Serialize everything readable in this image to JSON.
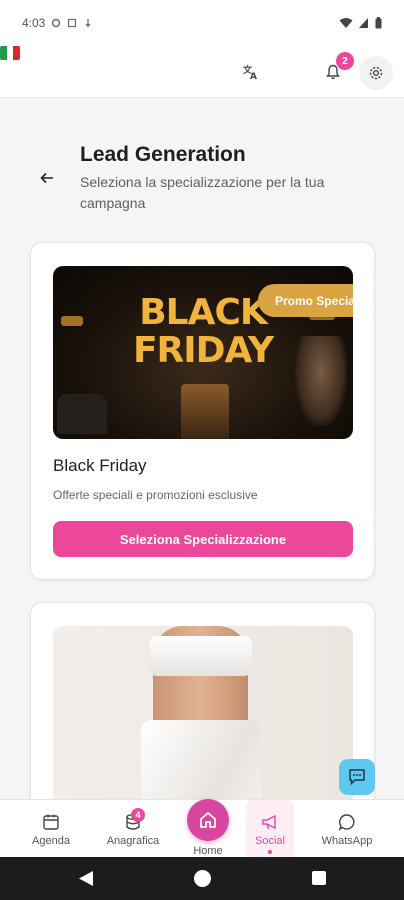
{
  "status_bar": {
    "time": "4:03"
  },
  "header": {
    "translate_icon": "translate-icon",
    "flag": "italy-flag",
    "notifications_count": "2",
    "settings_icon": "gear-icon"
  },
  "page": {
    "title": "Lead Generation",
    "subtitle": "Seleziona la specializzazione per la tua campagna"
  },
  "cards": [
    {
      "image_text_line1": "BLACK",
      "image_text_line2": "FRIDAY",
      "badge": "Promo Speciale",
      "title": "Black Friday",
      "description": "Offerte speciali e promozioni esclusive",
      "button": "Seleziona Specializzazione"
    },
    {
      "image": "model-in-white-outfit"
    }
  ],
  "nav": {
    "agenda": "Agenda",
    "anagrafica": "Anagrafica",
    "anagrafica_badge": "4",
    "home": "Home",
    "social": "Social",
    "whatsapp": "WhatsApp"
  },
  "colors": {
    "accent": "#ec4899",
    "promo_badge": "#d9a441",
    "chat_fab": "#5ec8ee"
  }
}
